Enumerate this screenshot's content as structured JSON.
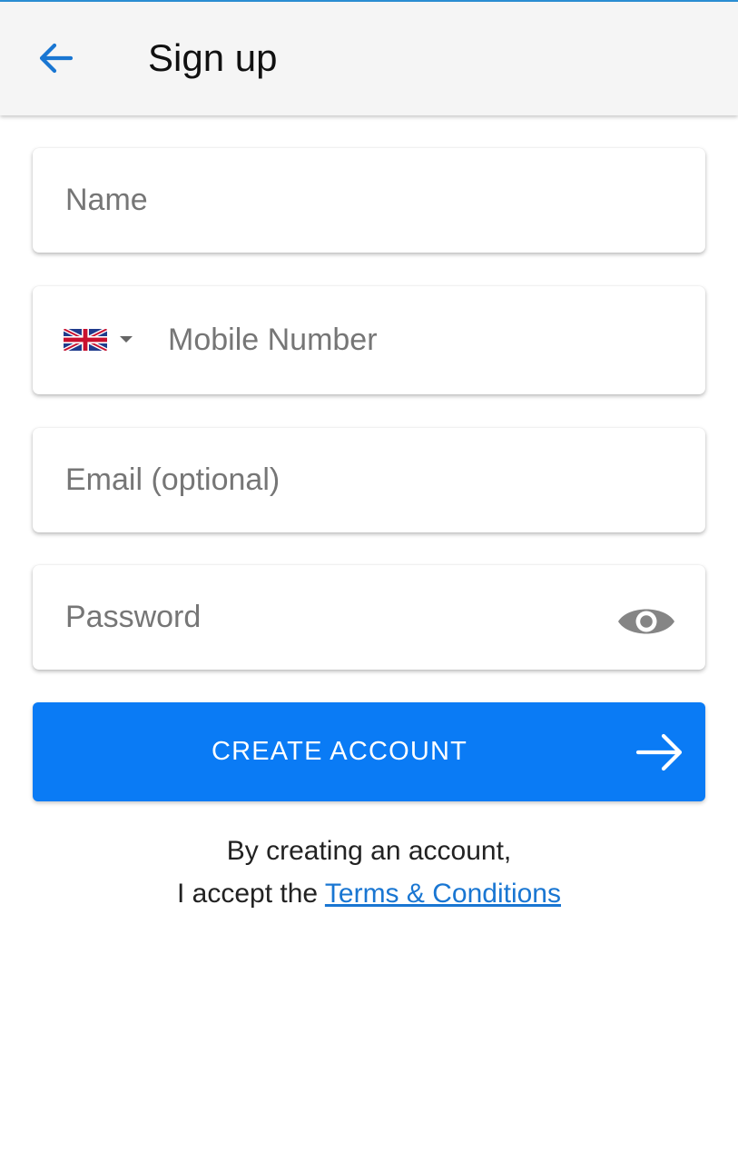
{
  "header": {
    "title": "Sign up",
    "back_icon": "arrow-left-icon"
  },
  "form": {
    "name": {
      "placeholder": "Name",
      "value": ""
    },
    "mobile": {
      "country": "United Kingdom",
      "flag_icon": "uk-flag-icon",
      "dropdown_icon": "caret-down-icon",
      "placeholder": "Mobile Number",
      "value": ""
    },
    "email": {
      "placeholder": "Email (optional)",
      "value": ""
    },
    "password": {
      "placeholder": "Password",
      "value": "",
      "toggle_icon": "eye-icon"
    }
  },
  "actions": {
    "create_label": "CREATE ACCOUNT",
    "create_icon": "arrow-right-icon"
  },
  "terms": {
    "line1": "By creating an account,",
    "prefix": "I accept the ",
    "link": "Terms & Conditions"
  },
  "colors": {
    "accent": "#0a7bf5",
    "link": "#1976d2",
    "app_bar_bg": "#f5f5f5",
    "top_line": "#2b8fd6",
    "icon_gray": "#858585"
  }
}
